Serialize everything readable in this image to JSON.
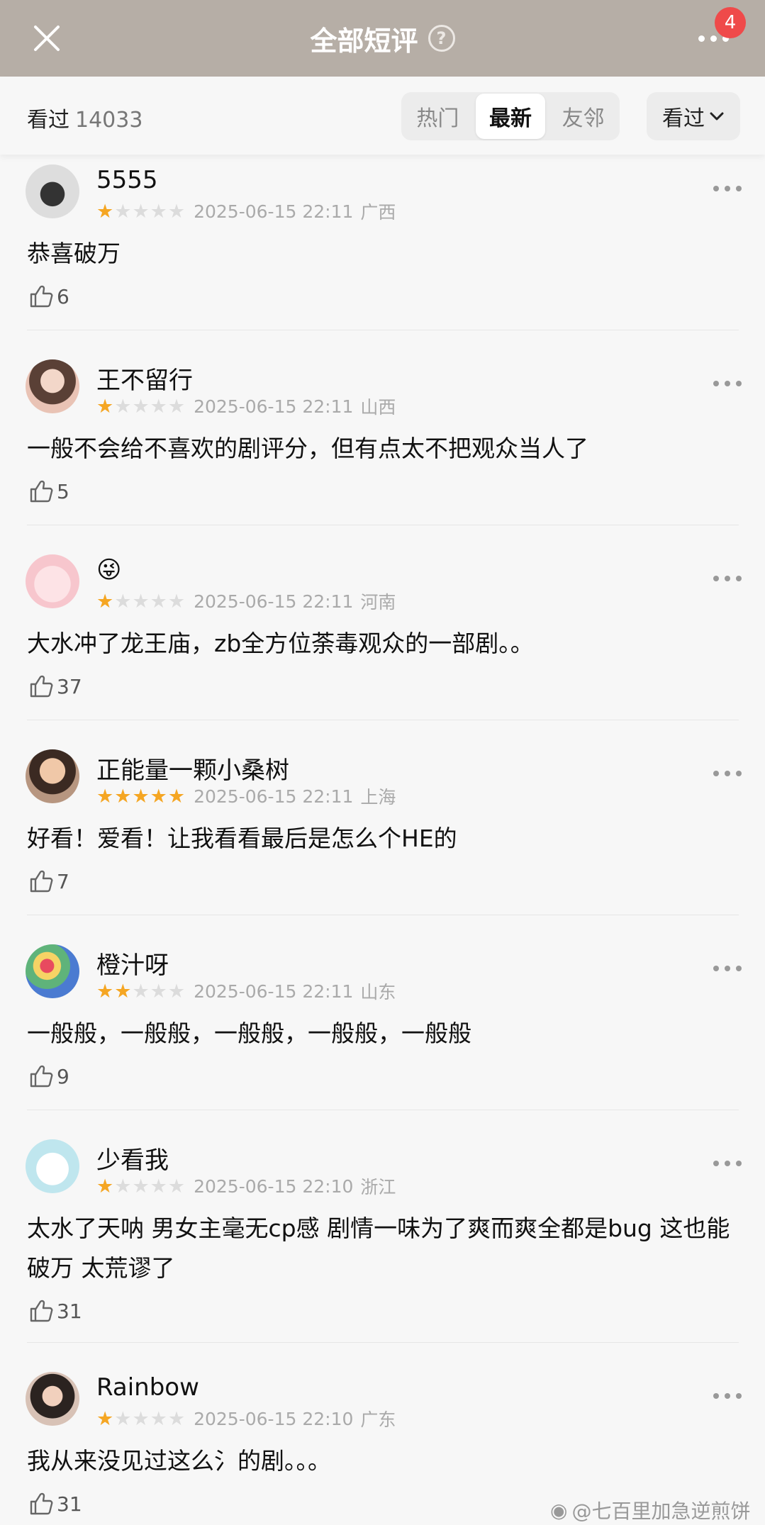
{
  "header": {
    "title": "全部短评",
    "help_glyph": "?",
    "notification_count": "4"
  },
  "subbar": {
    "watched_label": "看过",
    "watched_count": "14033",
    "tabs": [
      "热门",
      "最新",
      "友邻"
    ],
    "active_tab": "最新",
    "filter_label": "看过"
  },
  "reviews": [
    {
      "user": "5555",
      "rating": 1,
      "time": "2025-06-15 22:11",
      "location": "广西",
      "text": "恭喜破万",
      "likes": "6"
    },
    {
      "user": "王不留行",
      "rating": 1,
      "time": "2025-06-15 22:11",
      "location": "山西",
      "text": "一般不会给不喜欢的剧评分，但有点太不把观众当人了",
      "likes": "5"
    },
    {
      "user": "😜",
      "rating": 1,
      "time": "2025-06-15 22:11",
      "location": "河南",
      "text": "大水冲了龙王庙，zb全方位荼毒观众的一部剧。。",
      "likes": "37"
    },
    {
      "user": "正能量一颗小桑树",
      "rating": 5,
      "time": "2025-06-15 22:11",
      "location": "上海",
      "text": "好看！爱看！让我看看最后是怎么个HE的",
      "likes": "7"
    },
    {
      "user": "橙汁呀",
      "rating": 2,
      "time": "2025-06-15 22:11",
      "location": "山东",
      "text": "一般般，一般般，一般般，一般般，一般般",
      "likes": "9"
    },
    {
      "user": "少看我",
      "rating": 1,
      "time": "2025-06-15 22:10",
      "location": "浙江",
      "text": "太水了天呐 男女主毫无cp感 剧情一味为了爽而爽全都是bug 这也能破万 太荒谬了",
      "likes": "31"
    },
    {
      "user": "Rainbow",
      "rating": 1,
      "time": "2025-06-15 22:10",
      "location": "广东",
      "text": "我从来没见过这么氵的剧。。。",
      "likes": "31"
    }
  ],
  "watermark": "@七百里加急逆煎饼",
  "colors": {
    "header_bg": "#b6aea6",
    "star_on": "#f5a623",
    "star_off": "#dcdcdc",
    "badge": "#ef4a4a"
  }
}
